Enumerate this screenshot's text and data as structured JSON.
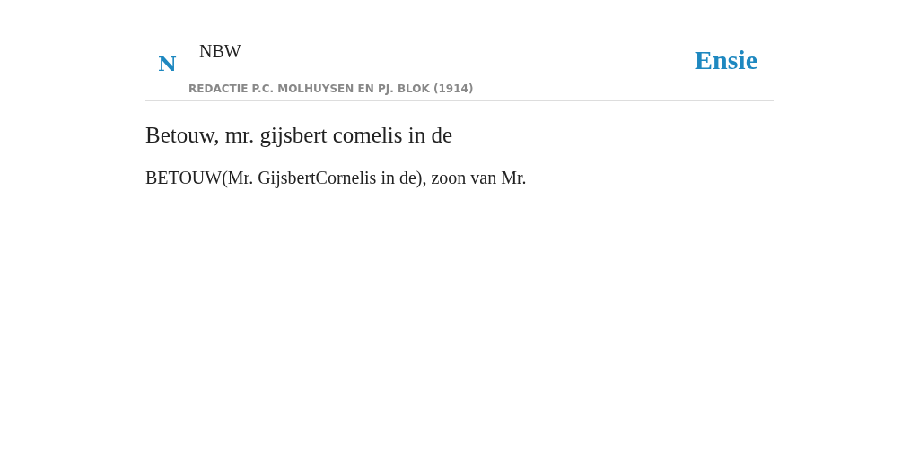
{
  "header": {
    "logo_letter": "N",
    "source": "NBW",
    "subtitle": "REDACTIE P.C. MOLHUYSEN EN PJ. BLOK (1914)",
    "brand": "Ensie"
  },
  "article": {
    "title": "Betouw, mr. gijsbert comelis in de",
    "body": "BETOUW(Mr. GijsbertCornelis in de), zoon van Mr."
  }
}
